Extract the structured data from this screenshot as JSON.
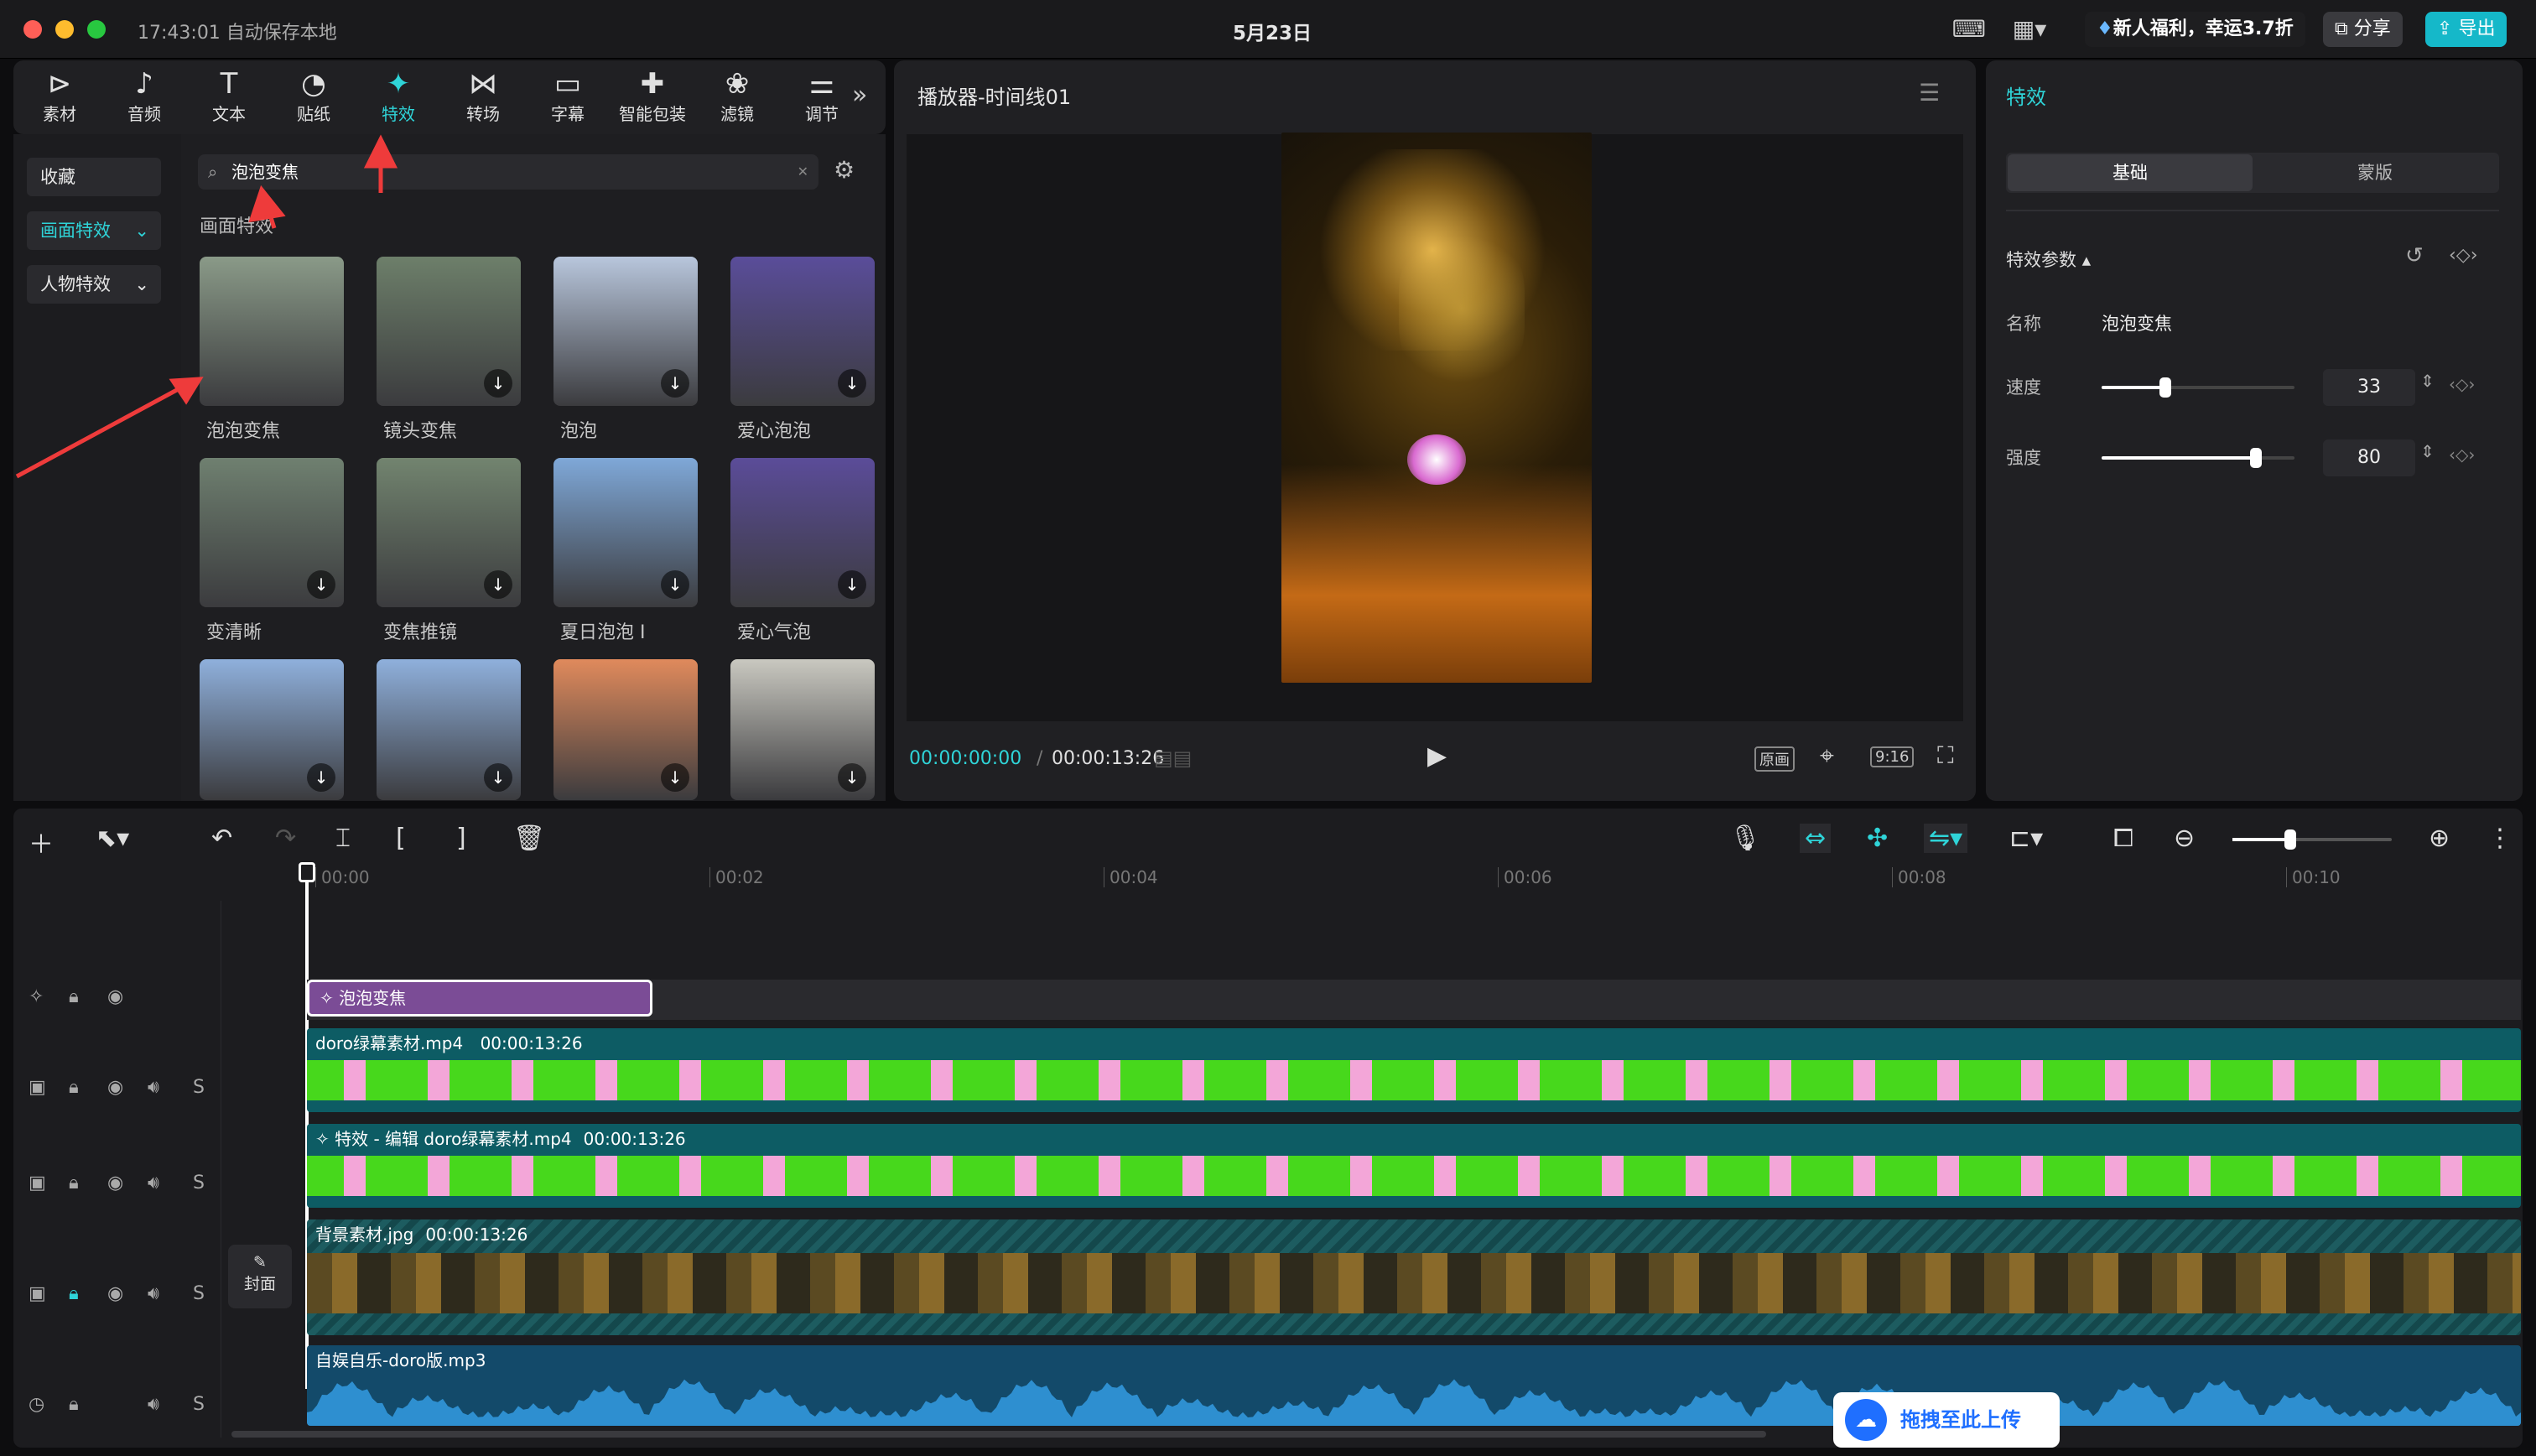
{
  "titlebar": {
    "autosave": "17:43:01 自动保存本地",
    "date": "5月23日",
    "promo": "新人福利，幸运3.7折",
    "share": "分享",
    "export": "导出"
  },
  "media_tabs": [
    {
      "label": "素材",
      "icon": "play-box-icon"
    },
    {
      "label": "音频",
      "icon": "music-note-icon"
    },
    {
      "label": "文本",
      "icon": "text-icon"
    },
    {
      "label": "贴纸",
      "icon": "sticker-icon"
    },
    {
      "label": "特效",
      "icon": "star-effect-icon"
    },
    {
      "label": "转场",
      "icon": "transition-icon"
    },
    {
      "label": "字幕",
      "icon": "subtitle-icon"
    },
    {
      "label": "智能包装",
      "icon": "smart-pack-icon"
    },
    {
      "label": "滤镜",
      "icon": "filter-icon"
    },
    {
      "label": "调节",
      "icon": "adjust-icon"
    }
  ],
  "categories": [
    "收藏",
    "画面特效",
    "人物特效"
  ],
  "search": {
    "value": "泡泡变焦"
  },
  "section_title": "画面特效",
  "effects": [
    {
      "label": "泡泡变焦",
      "bg": "#8a9a88"
    },
    {
      "label": "镜头变焦",
      "bg": "#6d7f6a"
    },
    {
      "label": "泡泡",
      "bg": "#b8c6dc"
    },
    {
      "label": "爱心泡泡",
      "bg": "#5a4d9a"
    },
    {
      "label": "变清晰",
      "bg": "#6f8070"
    },
    {
      "label": "变焦推镜",
      "bg": "#72846f"
    },
    {
      "label": "夏日泡泡 I",
      "bg": "#7fa8d8"
    },
    {
      "label": "爱心气泡",
      "bg": "#5b4c99"
    },
    {
      "label": "",
      "bg": "#8fb0dc"
    },
    {
      "label": "",
      "bg": "#8fb0dc"
    },
    {
      "label": "",
      "bg": "#e08a5c"
    },
    {
      "label": "",
      "bg": "#c9c8c0"
    }
  ],
  "player": {
    "title": "播放器-时间线01",
    "time_current": "00:00:00:00",
    "time_total": "00:00:13:26",
    "original": "原画",
    "ratio": "9:16"
  },
  "props": {
    "title": "特效",
    "tabs": [
      "基础",
      "蒙版"
    ],
    "section": "特效参数",
    "name_label": "名称",
    "name_value": "泡泡变焦",
    "speed_label": "速度",
    "speed_value": "33",
    "speed_fraction": 0.33,
    "strength_label": "强度",
    "strength_value": "80",
    "strength_fraction": 0.8
  },
  "timeline": {
    "ticks": [
      "00:00",
      "00:02",
      "00:04",
      "00:06",
      "00:08",
      "00:10"
    ],
    "effect_clip": "泡泡变焦",
    "tracks": [
      {
        "name": "doro绿幕素材.mp4",
        "duration": "00:00:13:26"
      },
      {
        "name": "特效 - 编辑  doro绿幕素材.mp4",
        "duration": "00:00:13:26"
      },
      {
        "name": "背景素材.jpg",
        "duration": "00:00:13:26"
      },
      {
        "name": "自娱自乐-doro版.mp3",
        "duration": ""
      }
    ],
    "cover": "封面",
    "upload": "拖拽至此上传"
  }
}
